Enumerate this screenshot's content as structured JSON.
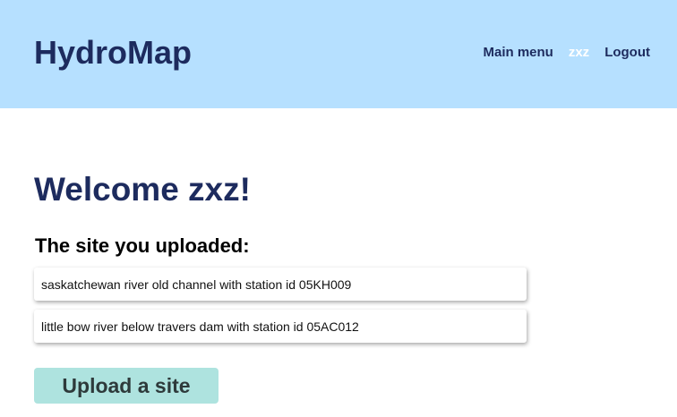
{
  "header": {
    "brand": "HydroMap",
    "nav": {
      "main_menu": "Main menu",
      "user": "zxz",
      "logout": "Logout"
    }
  },
  "main": {
    "welcome": "Welcome zxz!",
    "section_title": "The site you uploaded:",
    "sites": [
      {
        "label": "saskatchewan river old channel with station id 05KH009"
      },
      {
        "label": "little bow river below travers dam with station id 05AC012"
      }
    ],
    "upload_button": "Upload a site"
  },
  "colors": {
    "header_bg": "#b6e0ff",
    "brand_text": "#1d2b5e",
    "nav_user_text": "#ffffff",
    "upload_button_bg": "#aee3df"
  }
}
